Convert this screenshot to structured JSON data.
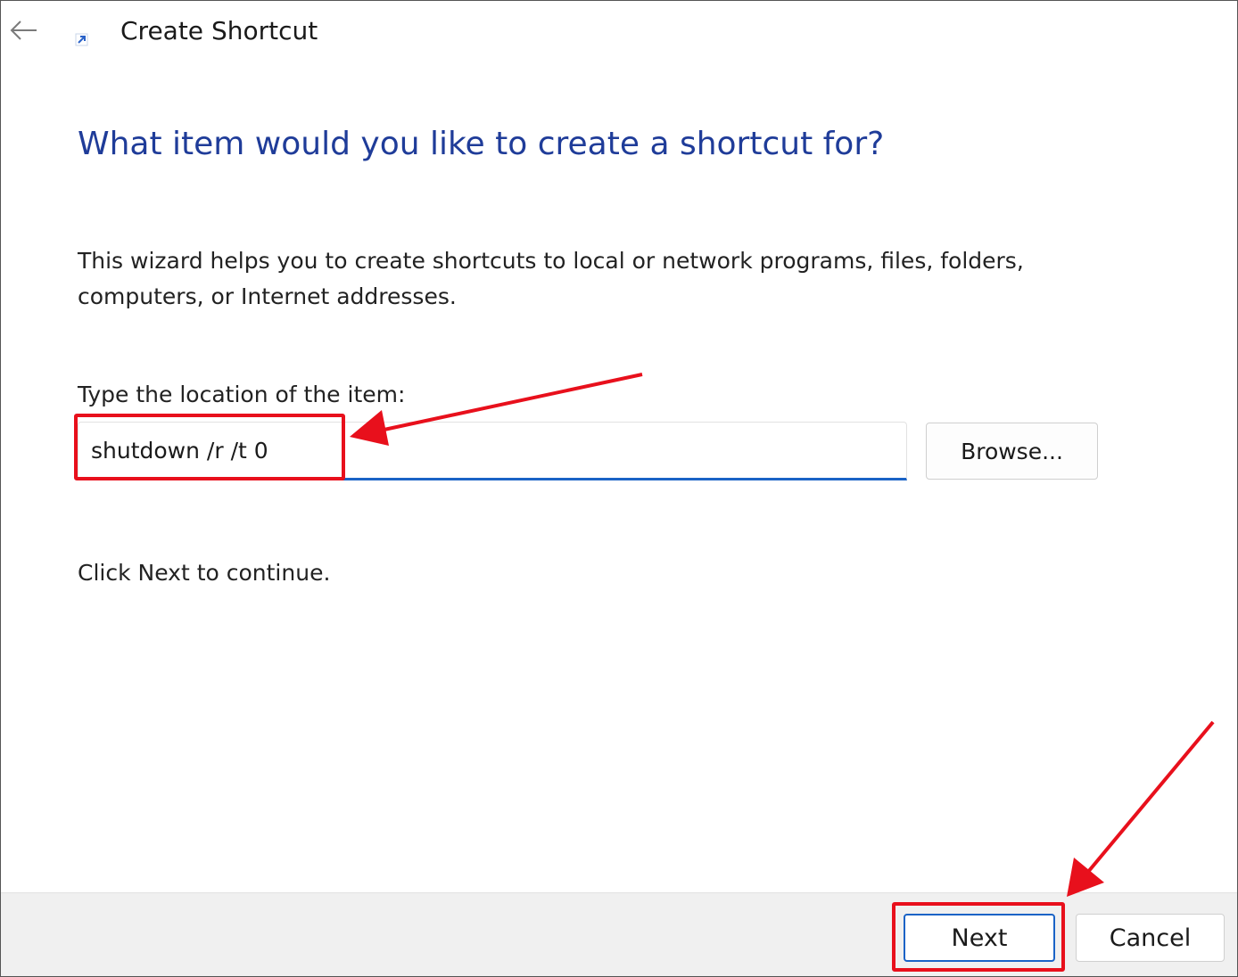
{
  "window": {
    "title": "Create Shortcut"
  },
  "titlebar": {
    "back_icon": "arrow-left-icon",
    "app_icon": "shortcut-arrow-icon"
  },
  "main": {
    "heading": "What item would you like to create a shortcut for?",
    "description": "This wizard helps you to create shortcuts to local or network programs, files, folders, computers, or Internet addresses.",
    "location_label": "Type the location of the item:",
    "location_value": "shutdown /r /t 0",
    "browse_label": "Browse...",
    "continue_text": "Click Next to continue."
  },
  "footer": {
    "next_label": "Next",
    "cancel_label": "Cancel"
  },
  "colors": {
    "heading": "#1f3c99",
    "accent": "#1a63c6",
    "annotation_red": "#e8101c",
    "footer_bg": "#f0f0f0"
  }
}
